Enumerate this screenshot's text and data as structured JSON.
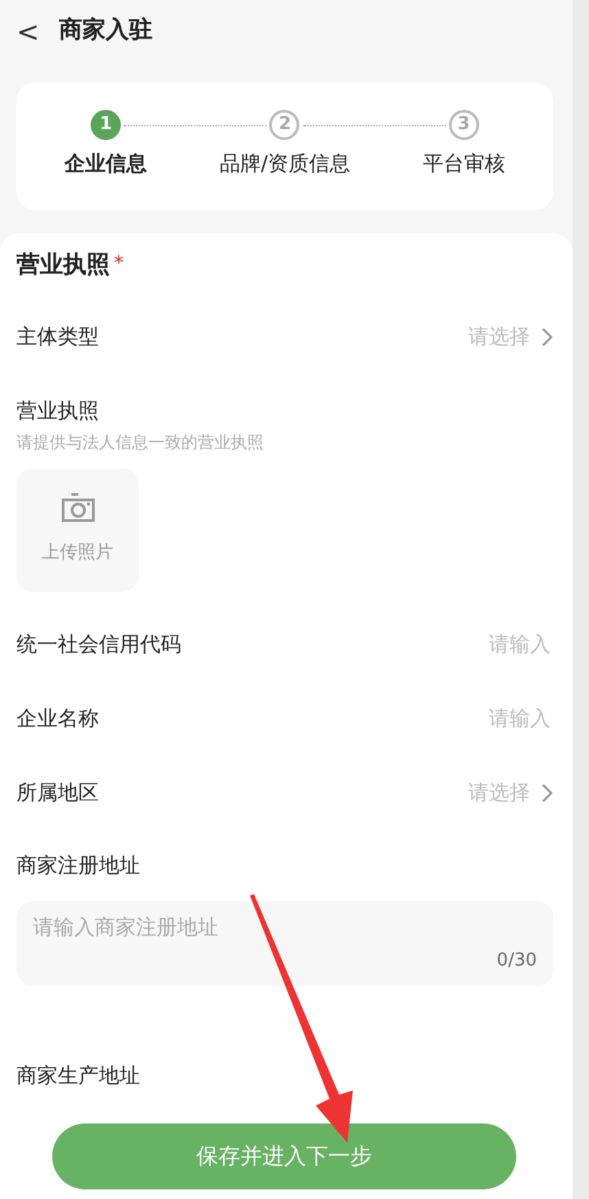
{
  "header": {
    "back": "<",
    "title": "商家入驻"
  },
  "steps": [
    {
      "number": "1",
      "label": "企业信息",
      "selected": true
    },
    {
      "number": "2",
      "label": "品牌/资质信息",
      "selected": false
    },
    {
      "number": "3",
      "label": "平台审核",
      "selected": false
    }
  ],
  "section": {
    "title": "营业执照",
    "required_mark": "*"
  },
  "fields": [
    {
      "kind": "select",
      "label": "主体类型",
      "placeholder": "请选择"
    },
    {
      "kind": "upload",
      "label": "营业执照",
      "hint": "请提供与法人信息一致的营业执照",
      "button": "上传照片"
    },
    {
      "kind": "input",
      "label": "统一社会信用代码",
      "placeholder": "请输入"
    },
    {
      "kind": "input",
      "label": "企业名称",
      "placeholder": "请输入"
    },
    {
      "kind": "select",
      "label": "所属地区",
      "placeholder": "请选择"
    },
    {
      "kind": "textarea",
      "label": "商家注册地址",
      "placeholder": "请输入商家注册地址",
      "counter": "0/30"
    },
    {
      "kind": "label",
      "label": "商家生产地址"
    }
  ],
  "submit": "保存并进入下一步"
}
